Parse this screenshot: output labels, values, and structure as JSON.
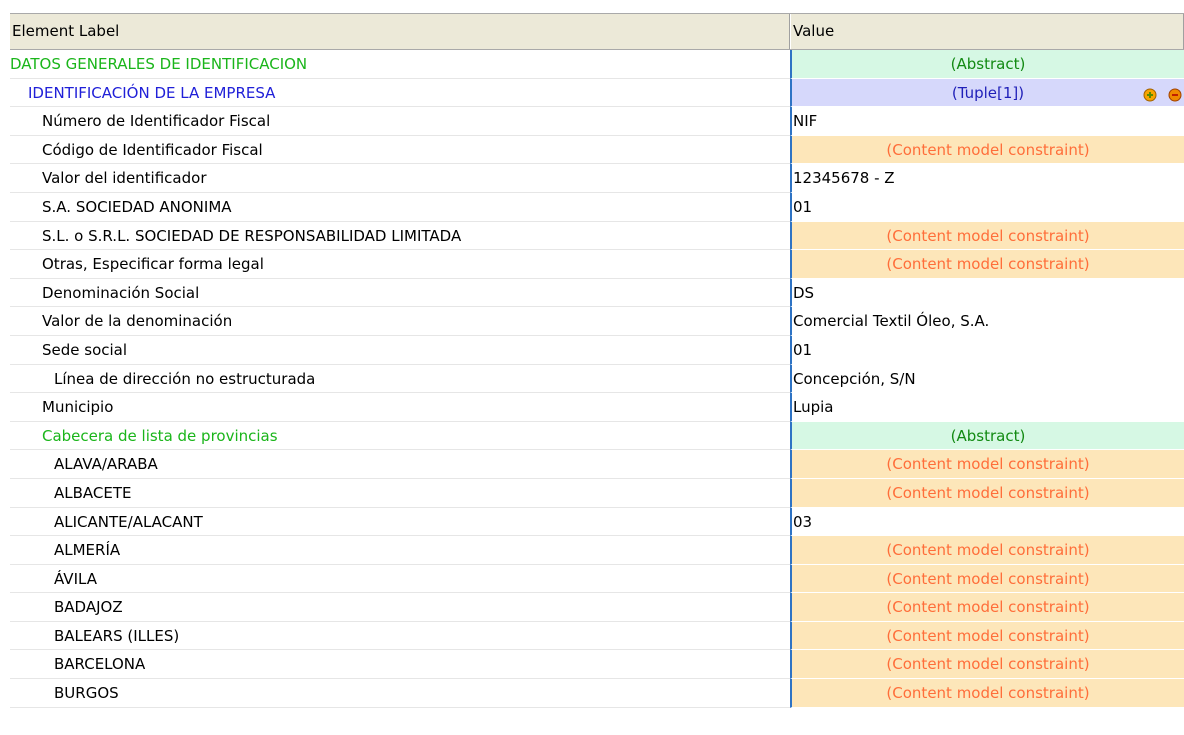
{
  "header": {
    "label_col": "Element Label",
    "value_col": "Value"
  },
  "rows": [
    {
      "label": "DATOS GENERALES DE IDENTIFICACION",
      "value": "(Abstract)",
      "kind": "abstract",
      "indent": 0,
      "label_color": "green"
    },
    {
      "label": "IDENTIFICACIÓN DE LA EMPRESA",
      "value": "(Tuple[1])",
      "kind": "tuple",
      "indent": 1,
      "label_color": "blue"
    },
    {
      "label": "Número de Identificador Fiscal",
      "value": "NIF",
      "kind": "text",
      "indent": 2
    },
    {
      "label": "Código de Identificador Fiscal",
      "value": "(Content model constraint)",
      "kind": "constraint",
      "indent": 2
    },
    {
      "label": "Valor del identificador",
      "value": "12345678 - Z",
      "kind": "text",
      "indent": 2
    },
    {
      "label": "S.A. SOCIEDAD ANONIMA",
      "value": "01",
      "kind": "text",
      "indent": 2
    },
    {
      "label": "S.L. o S.R.L. SOCIEDAD DE RESPONSABILIDAD LIMITADA",
      "value": "(Content model constraint)",
      "kind": "constraint",
      "indent": 2
    },
    {
      "label": "Otras, Especificar forma legal",
      "value": "(Content model constraint)",
      "kind": "constraint",
      "indent": 2
    },
    {
      "label": "Denominación Social",
      "value": "DS",
      "kind": "text",
      "indent": 2
    },
    {
      "label": "Valor de la denominación",
      "value": "Comercial Textil Óleo, S.A.",
      "kind": "text",
      "indent": 2
    },
    {
      "label": "Sede social",
      "value": "01",
      "kind": "text",
      "indent": 2
    },
    {
      "label": "Línea de dirección no estructurada",
      "value": "Concepción, S/N",
      "kind": "text",
      "indent": 3
    },
    {
      "label": "Municipio",
      "value": "Lupia",
      "kind": "text",
      "indent": 2
    },
    {
      "label": "Cabecera de lista de provincias",
      "value": "(Abstract)",
      "kind": "abstract",
      "indent": 2,
      "label_color": "green"
    },
    {
      "label": "ALAVA/ARABA",
      "value": "(Content model constraint)",
      "kind": "constraint",
      "indent": 3
    },
    {
      "label": "ALBACETE",
      "value": "(Content model constraint)",
      "kind": "constraint",
      "indent": 3
    },
    {
      "label": "ALICANTE/ALACANT",
      "value": "03",
      "kind": "text",
      "indent": 3
    },
    {
      "label": "ALMERÍA",
      "value": "(Content model constraint)",
      "kind": "constraint",
      "indent": 3
    },
    {
      "label": "ÁVILA",
      "value": "(Content model constraint)",
      "kind": "constraint",
      "indent": 3
    },
    {
      "label": "BADAJOZ",
      "value": "(Content model constraint)",
      "kind": "constraint",
      "indent": 3
    },
    {
      "label": "BALEARS (ILLES)",
      "value": "(Content model constraint)",
      "kind": "constraint",
      "indent": 3
    },
    {
      "label": "BARCELONA",
      "value": "(Content model constraint)",
      "kind": "constraint",
      "indent": 3
    },
    {
      "label": "BURGOS",
      "value": "(Content model constraint)",
      "kind": "constraint",
      "indent": 3
    }
  ],
  "icons": {
    "tuple_actions": [
      "add-tuple-icon",
      "remove-tuple-icon"
    ]
  },
  "colors": {
    "abstract_bg": "#d6f8e4",
    "abstract_text": "#128a12",
    "constraint_bg": "#fde6b9",
    "constraint_text": "#ff6e3a",
    "tuple_bg": "#d6d8fb",
    "tuple_text": "#1f1fb8",
    "label_green": "#1ab51a",
    "label_blue": "#2020d8"
  }
}
